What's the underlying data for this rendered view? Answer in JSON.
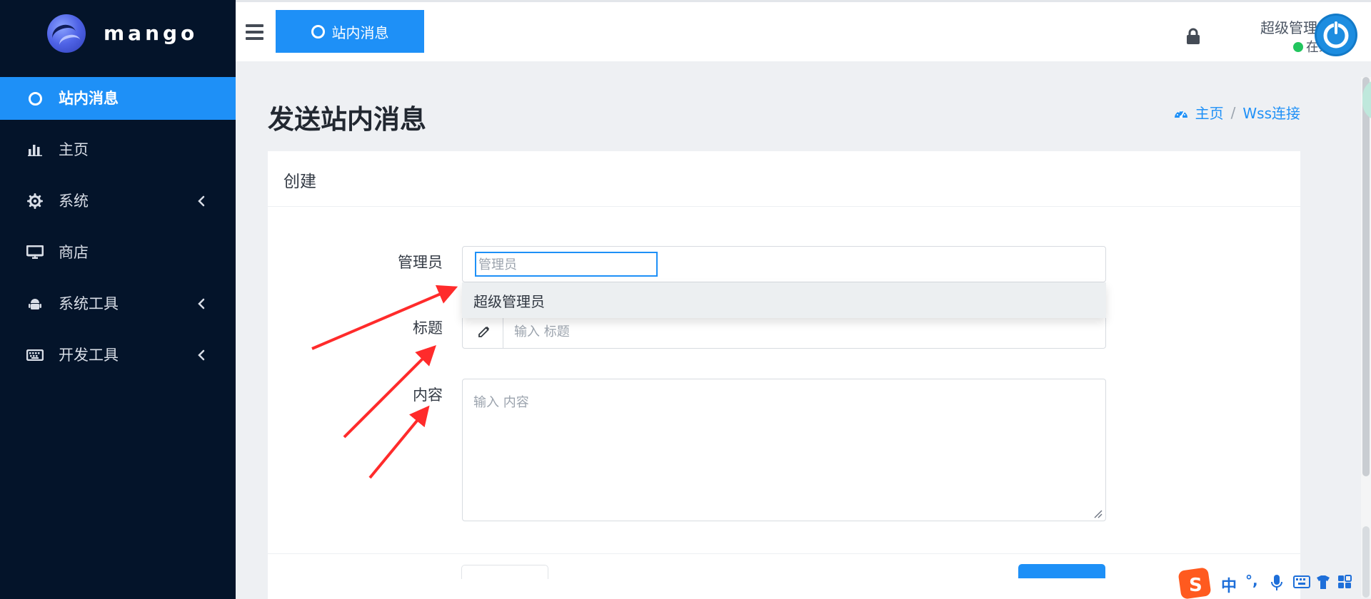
{
  "app": {
    "brand": "mango"
  },
  "sidebar": {
    "items": [
      {
        "label": "站内消息",
        "icon": "circle-icon",
        "active": true,
        "has_submenu": false
      },
      {
        "label": "主页",
        "icon": "bar-chart-icon",
        "active": false,
        "has_submenu": false
      },
      {
        "label": "系统",
        "icon": "gear-icon",
        "active": false,
        "has_submenu": true
      },
      {
        "label": "商店",
        "icon": "desktop-icon",
        "active": false,
        "has_submenu": false
      },
      {
        "label": "系统工具",
        "icon": "android-icon",
        "active": false,
        "has_submenu": true
      },
      {
        "label": "开发工具",
        "icon": "keyboard-icon",
        "active": false,
        "has_submenu": true
      }
    ]
  },
  "topbar": {
    "tab_label": "站内消息",
    "user": {
      "name": "超级管理员",
      "status": "在线"
    }
  },
  "page": {
    "title": "发送站内消息",
    "breadcrumb": [
      "主页",
      "Wss连接"
    ],
    "card_title": "创建"
  },
  "form": {
    "admin": {
      "label": "管理员",
      "placeholder": "管理员",
      "options": [
        "超级管理员"
      ]
    },
    "title": {
      "label": "标题",
      "placeholder": "输入 标题"
    },
    "content": {
      "label": "内容",
      "placeholder": "输入 内容"
    }
  },
  "ime": {
    "language": "中",
    "punctuation": "°,"
  },
  "colors": {
    "sidebar": "#04142a",
    "accent": "#1e90f7",
    "status_online": "#22c55e",
    "arrow": "#ff2b2b"
  }
}
